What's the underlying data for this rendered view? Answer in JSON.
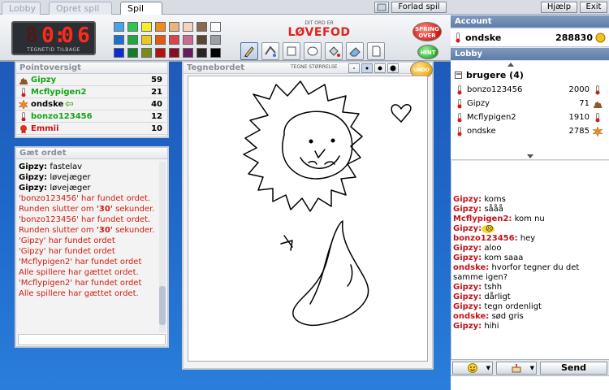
{
  "tabs": [
    {
      "label": "Lobby"
    },
    {
      "label": "Opret spil"
    },
    {
      "label": "Spil"
    }
  ],
  "top_buttons": {
    "leave": "Forlad spil",
    "help": "Hjælp",
    "exit": "Exit"
  },
  "timer": {
    "digits": "0:06",
    "label": "TEGNETID TILBAGE"
  },
  "word": {
    "hint_label": "DIT ORD ER",
    "value": "LØVEFOD"
  },
  "buttons": {
    "skip": "SPRING OVER",
    "hint": "HINT",
    "undo": "UNDO"
  },
  "palette": [
    "#4aa2e8",
    "#29c75a",
    "#f3ef2a",
    "#f08b1e",
    "#e8b47f",
    "#f2d2c3",
    "#8a6a4b",
    "#ffffff",
    "#1e6fd1",
    "#20a83c",
    "#e8c91d",
    "#e05b10",
    "#d8434e",
    "#c96c8f",
    "#5b4636",
    "#9aa0a6",
    "#0c2bd1",
    "#0f7d27",
    "#7a8b1b",
    "#b3130f",
    "#8a0d28",
    "#6a1b5f",
    "#2b2221",
    "#000000"
  ],
  "tools": [
    "pencil-icon",
    "bucket-line-icon",
    "rectangle-icon",
    "ellipse-icon",
    "fill-icon",
    "eraser-icon",
    "page-icon"
  ],
  "points_panel": {
    "title": "Pointoversigt",
    "rows": [
      {
        "name": "Gipzy",
        "score": "59",
        "color": "#16a516",
        "icon": "poo-icon"
      },
      {
        "name": "Mcflypigen2",
        "score": "21",
        "color": "#16a516",
        "icon": "thermometer-icon"
      },
      {
        "name": "ondske",
        "score": "40",
        "color": "#000000",
        "icon": "splat-icon"
      },
      {
        "name": "bonzo123456",
        "score": "12",
        "color": "#16a516",
        "icon": "thermometer-icon"
      },
      {
        "name": "Emmii",
        "score": "10",
        "color": "#d01010",
        "icon": "medal-icon"
      }
    ]
  },
  "guess_panel": {
    "title": "Gæt  ordet",
    "lines": [
      {
        "who": "Gipzy:",
        "text": " fastelav",
        "system": false
      },
      {
        "who": "Gipzy:",
        "text": " løvejæger",
        "system": false
      },
      {
        "who": "Gipzy:",
        "text": " løvejæger",
        "system": false
      },
      {
        "who": "",
        "text": "'bonzo123456' har fundet ordet. Runden slutter om '30' sekunder.",
        "system": true
      },
      {
        "who": "",
        "text": "'bonzo123456' har fundet ordet. Runden slutter om '30' sekunder.",
        "system": true
      },
      {
        "who": "",
        "text": "'Gipzy' har fundet ordet",
        "system": true
      },
      {
        "who": "",
        "text": "'Gipzy' har fundet ordet",
        "system": true
      },
      {
        "who": "",
        "text": "'Mcflypigen2' har fundet ordet",
        "system": true
      },
      {
        "who": "",
        "text": "Alle spillere har gættet ordet.",
        "system": true
      },
      {
        "who": "",
        "text": "'Mcflypigen2' har fundet ordet",
        "system": true
      },
      {
        "who": "",
        "text": "Alle spillere har gættet ordet.",
        "system": true
      }
    ]
  },
  "board": {
    "title": "Tegnebordet",
    "size_label": "TEGNE STØRRELSE"
  },
  "account": {
    "title": "Account",
    "user": "ondske",
    "coins": "288830"
  },
  "lobby": {
    "title": "Lobby",
    "group": "brugere (4)",
    "users": [
      {
        "name": "bonzo123456",
        "score": "2000",
        "icon": "thermometer-icon"
      },
      {
        "name": "Gipzy",
        "score": "71",
        "icon": "poo-icon"
      },
      {
        "name": "Mcflypigen2",
        "score": "1910",
        "icon": "thermometer-icon"
      },
      {
        "name": "ondske",
        "score": "2785",
        "icon": "splat-icon"
      }
    ]
  },
  "chat": {
    "lines": [
      {
        "who": "Gipzy:",
        "text": " koms",
        "color": "#c0141a"
      },
      {
        "who": "Gipzy:",
        "text": " sååå",
        "color": "#c0141a"
      },
      {
        "who": "Mcflypigen2:",
        "text": " kom nu",
        "color": "#c0141a"
      },
      {
        "who": "Gipzy:",
        "text": " ☹",
        "color": "#c0141a"
      },
      {
        "who": "bonzo123456:",
        "text": " hey",
        "color": "#c0141a"
      },
      {
        "who": "Gipzy:",
        "text": " aloo",
        "color": "#c0141a"
      },
      {
        "who": "Gipzy:",
        "text": " kom saaa",
        "color": "#c0141a"
      },
      {
        "who": "ondske:",
        "text": " hvorfor tegner du det samme igen?",
        "color": "#c0141a"
      },
      {
        "who": "Gipzy:",
        "text": " tshh",
        "color": "#c0141a"
      },
      {
        "who": "Gipzy:",
        "text": " dårligt",
        "color": "#c0141a"
      },
      {
        "who": "Gipzy:",
        "text": " tegn ordenligt",
        "color": "#c0141a"
      },
      {
        "who": "ondske:",
        "text": " sød gris",
        "color": "#c0141a"
      },
      {
        "who": "Gipzy:",
        "text": " hihi",
        "color": "#c0141a"
      }
    ],
    "send": "Send"
  }
}
